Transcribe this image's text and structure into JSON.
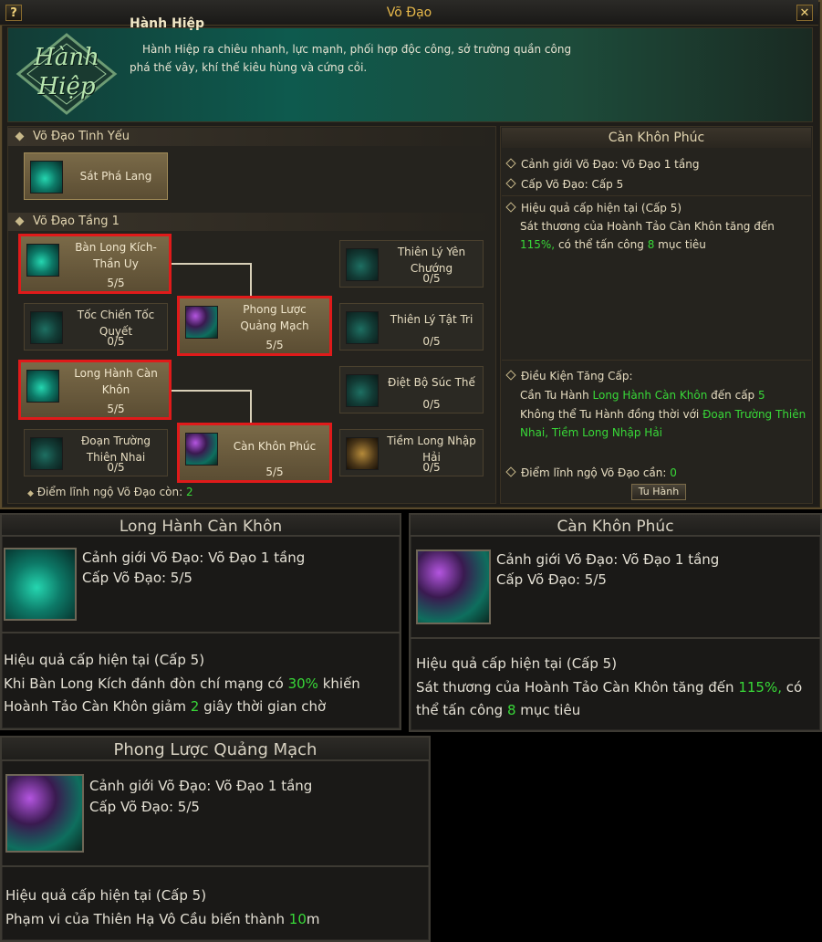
{
  "window": {
    "title": "Võ Đạo",
    "help_glyph": "?",
    "close_glyph": "✕"
  },
  "banner": {
    "emblem_line1": "Hành",
    "emblem_line2": "Hiệp",
    "name": "Hành Hiệp",
    "description": "Hành Hiệp ra chiêu nhanh, lực mạnh, phối hợp độc công, sở trường quần công phá thế vây, khí thế kiêu hùng và cứng cỏi."
  },
  "tree": {
    "section_essence": "Võ Đạo Tinh Yếu",
    "section_tier1": "Võ Đạo Tầng 1",
    "essence_skill": "Sát Phá Lang",
    "skills": {
      "ban_long": {
        "name": "Bàn Long Kích-Thần Uy",
        "level": "5/5"
      },
      "toc_chien": {
        "name": "Tốc Chiến Tốc Quyết",
        "level": "0/5"
      },
      "phong_luoc": {
        "name": "Phong Lược Quảng Mạch",
        "level": "5/5"
      },
      "long_hanh": {
        "name": "Long Hành Càn Khôn",
        "level": "5/5"
      },
      "doan_truong": {
        "name": "Đoạn Trường Thiên Nhai",
        "level": "0/5"
      },
      "can_khon": {
        "name": "Càn Khôn Phúc",
        "level": "5/5"
      },
      "thien_ly_yen": {
        "name": "Thiên Lý Yên Chướng",
        "level": "0/5"
      },
      "thien_ly_tat": {
        "name": "Thiên Lý Tật Tri",
        "level": "0/5"
      },
      "diet_bo": {
        "name": "Điệt Bộ Súc Thế",
        "level": "0/5"
      },
      "tiem_long": {
        "name": "Tiềm Long Nhập Hải",
        "level": "0/5"
      }
    },
    "points_label": "Điểm lĩnh ngộ Võ Đạo còn:",
    "points_value": "2"
  },
  "info": {
    "title": "Càn Khôn Phúc",
    "realm": "Cảnh giới Võ Đạo: Võ Đạo 1 tầng",
    "level": "Cấp Võ Đạo: Cấp 5",
    "effect_head": "Hiệu quả cấp hiện tại (Cấp 5)",
    "effect_a": "Sát thương của Hoành Tảo Càn Khôn tăng đến",
    "effect_pct": "115%,",
    "effect_b": "có thể tấn công",
    "effect_num": "8",
    "effect_c": "mục tiêu",
    "cond_head": "Điều Kiện Tăng Cấp:",
    "cond1_a": "Cần Tu Hành",
    "cond1_skill": "Long Hành Càn Khôn",
    "cond1_b": "đến cấp",
    "cond1_lv": "5",
    "cond2_a": "Không thể Tu Hành đồng thời với",
    "cond2_skills": "Đoạn Trường Thiên Nhai, Tiềm Long Nhập Hải",
    "need_label": "Điểm lĩnh ngộ Võ Đạo cần:",
    "need_value": "0",
    "button": "Tu Hành"
  },
  "cards": {
    "long_hanh": {
      "title": "Long Hành Càn Khôn",
      "realm": "Cảnh giới Võ Đạo: Võ Đạo 1 tầng",
      "level": "Cấp Võ Đạo: 5/5",
      "effect_head": "Hiệu quả cấp hiện tại (Cấp 5)",
      "e1": "Khi Bàn Long Kích đánh đòn chí mạng có",
      "e_pct": "30%",
      "e2": "khiến Hoành Tảo Càn Khôn giảm",
      "e_num": "2",
      "e3": "giây thời gian chờ"
    },
    "can_khon": {
      "title": "Càn Khôn Phúc",
      "realm": "Cảnh giới Võ Đạo: Võ Đạo 1 tầng",
      "level": "Cấp Võ Đạo: 5/5",
      "effect_head": "Hiệu quả cấp hiện tại (Cấp 5)",
      "e1": "Sát thương của Hoành Tảo Càn Khôn tăng đến",
      "e_pct": "115%,",
      "e2": "có thể tấn công",
      "e_num": "8",
      "e3": "mục tiêu"
    },
    "phong_luoc": {
      "title": "Phong Lược Quảng Mạch",
      "realm": "Cảnh giới Võ Đạo: Võ Đạo 1 tầng",
      "level": "Cấp Võ Đạo: 5/5",
      "effect_head": "Hiệu quả cấp hiện tại (Cấp 5)",
      "e1": "Phạm vi của Thiên Hạ Vô Cầu biến thành",
      "e_num": "10",
      "e2": "m"
    }
  },
  "colors": {
    "highlight_green": "#38d838",
    "selection_red": "#e01a1a",
    "title_gold": "#e6b84a"
  },
  "icons": {
    "help": "question-mark-icon",
    "close": "close-icon",
    "skill_teal": "teal-dragon-icon",
    "skill_purple": "purple-orb-icon",
    "skill_gold": "golden-beast-icon"
  }
}
